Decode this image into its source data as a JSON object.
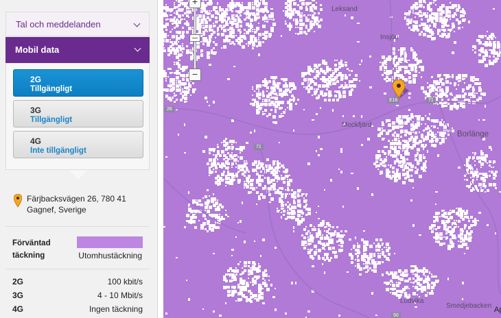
{
  "sidebar": {
    "sections": [
      {
        "label": "Tal och meddelanden",
        "expanded": false
      },
      {
        "label": "Mobil data",
        "expanded": true
      }
    ],
    "tech_buttons": [
      {
        "title": "2G",
        "status": "Tillgängligt",
        "selected": true
      },
      {
        "title": "3G",
        "status": "Tillgängligt",
        "selected": false
      },
      {
        "title": "4G",
        "status": "Inte tillgängligt",
        "selected": false
      }
    ],
    "address": {
      "line1": "Färjbacksvägen 26, 780 41",
      "line2": "Gagnef, Sverige"
    },
    "coverage": {
      "label_line1": "Förväntad",
      "label_line2": "täckning",
      "value": "Utomhustäckning",
      "color": "#bd86e1"
    },
    "speeds": [
      {
        "tech": "2G",
        "value": "100 kbit/s"
      },
      {
        "tech": "3G",
        "value": "4 - 10 Mbit/s"
      },
      {
        "tech": "4G",
        "value": "Ingen täckning"
      }
    ]
  },
  "map": {
    "coverage_color": "#b07ad6",
    "places": {
      "leksand": "Leksand",
      "insjon": "Insjön",
      "mockfjard": "Mockfjärd",
      "borlange": "Borlänge",
      "ludvika": "Ludvika",
      "smedjebacken": "Smedjebacken"
    },
    "road_shields": {
      "e16": "E16",
      "r71a": "71",
      "r71b": "71",
      "r26": "26",
      "r50": "50"
    },
    "edge_text": "Ap",
    "zoom_in_symbol": "+",
    "zoom_out_symbol": "−"
  }
}
